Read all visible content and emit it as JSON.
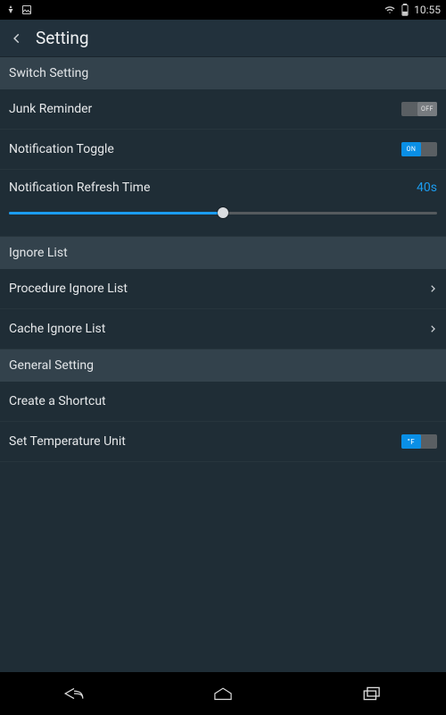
{
  "status": {
    "time": "10:55"
  },
  "header": {
    "title": "Setting"
  },
  "sections": {
    "switch": {
      "title": "Switch Setting"
    },
    "ignore": {
      "title": "Ignore List"
    },
    "general": {
      "title": "General Setting"
    }
  },
  "rows": {
    "junk_reminder": {
      "label": "Junk Reminder",
      "state": "OFF"
    },
    "notification_toggle": {
      "label": "Notification Toggle",
      "state": "ON"
    },
    "refresh_time": {
      "label": "Notification Refresh Time",
      "value": "40s",
      "percent": 50
    },
    "procedure_ignore": {
      "label": "Procedure Ignore List"
    },
    "cache_ignore": {
      "label": "Cache Ignore List"
    },
    "create_shortcut": {
      "label": "Create a Shortcut"
    },
    "set_temp_unit": {
      "label": "Set Temperature Unit",
      "unit": "°F"
    }
  },
  "colors": {
    "accent": "#1b9cf0"
  }
}
